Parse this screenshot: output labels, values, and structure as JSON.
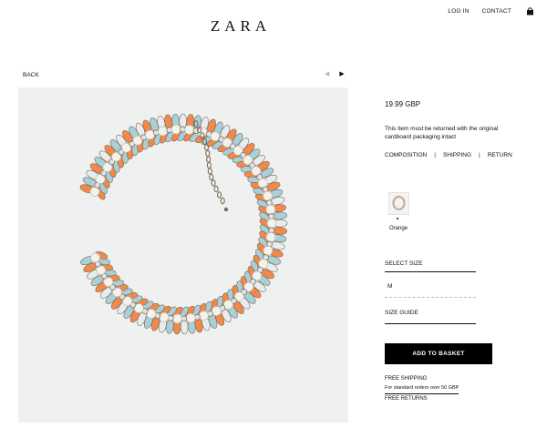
{
  "header": {
    "logo": "ZARA",
    "login_label": "LOG IN",
    "contact_label": "CONTACT"
  },
  "nav": {
    "back_label": "BACK",
    "prev_glyph": "◀",
    "next_glyph": "▶"
  },
  "product": {
    "price": "19.99 GBP",
    "return_note": "This item must be returned with the original cardboard packaging intact",
    "info_links": [
      "COMPOSITION",
      "SHIPPING",
      "RETURN"
    ],
    "color_name": "Orange",
    "select_size_label": "SELECT SIZE",
    "size_option": "M",
    "size_guide_label": "SIZE GUIDE",
    "add_to_basket_label": "ADD TO BASKET"
  },
  "shipping": {
    "free_shipping": "FREE SHIPPING",
    "free_shipping_note": "For standard orders over 50 GBP",
    "free_returns": "FREE RETURNS"
  },
  "colors": {
    "panel_bg": "#eff1f1",
    "stone_blue": "#a9cfd8",
    "stone_orange": "#f0894b",
    "pearl": "#f4f2ec",
    "metal": "#7b6b55"
  }
}
